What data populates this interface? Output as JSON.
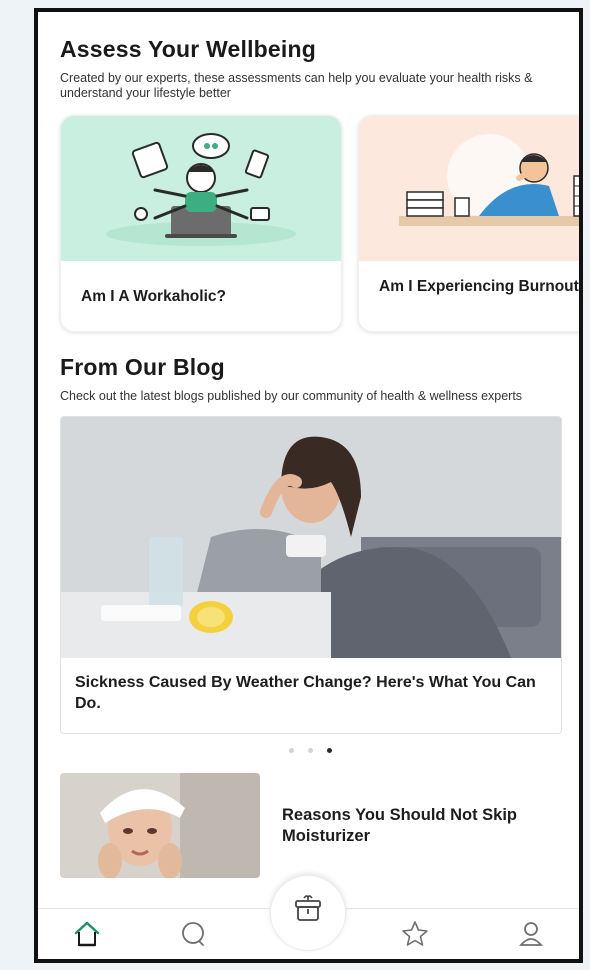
{
  "assess": {
    "title": "Assess Your Wellbeing",
    "subtitle": "Created by our experts, these assessments can help you evaluate your health risks & understand your lifestyle better",
    "cards": [
      {
        "label": "Am I A Workaholic?",
        "bg": "#c9efe0"
      },
      {
        "label": "Am I Experiencing Burnout?",
        "bg": "#fce8dc"
      }
    ]
  },
  "blog": {
    "title": "From Our Blog",
    "subtitle": "Check out the latest blogs published by our community of health & wellness experts",
    "featured_title": "Sickness Caused By Weather Change? Here's What You Can Do.",
    "carousel_active_index": 2,
    "carousel_count": 3,
    "list": [
      {
        "title": "Reasons You Should Not Skip Moisturizer"
      }
    ]
  },
  "tabbar": {
    "items": [
      {
        "icon": "home-icon"
      },
      {
        "icon": "chat-icon"
      },
      {
        "icon": "gift-box-icon"
      },
      {
        "icon": "star-icon"
      },
      {
        "icon": "profile-icon"
      }
    ],
    "active_color": "#1f8f6a"
  }
}
